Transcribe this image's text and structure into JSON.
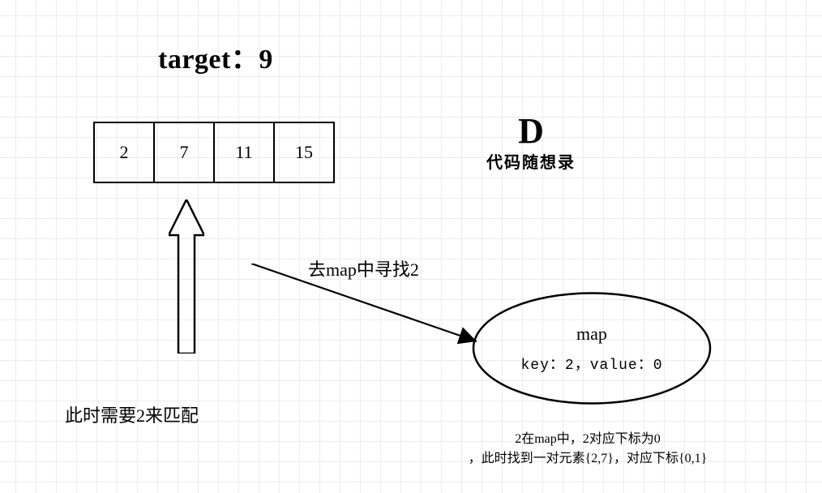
{
  "title": "target：9",
  "array": [
    "2",
    "7",
    "11",
    "15"
  ],
  "left_caption": "此时需要2来匹配",
  "seek_label": "去map中寻找2",
  "map": {
    "title": "map",
    "kv": "key：2，value：0"
  },
  "right_caption_line1": "2在map中，2对应下标为0",
  "right_caption_line2": "，此时找到一对元素{2,7}，对应下标{0,1}",
  "brand": {
    "letter": "D",
    "name": "代码随想录"
  }
}
